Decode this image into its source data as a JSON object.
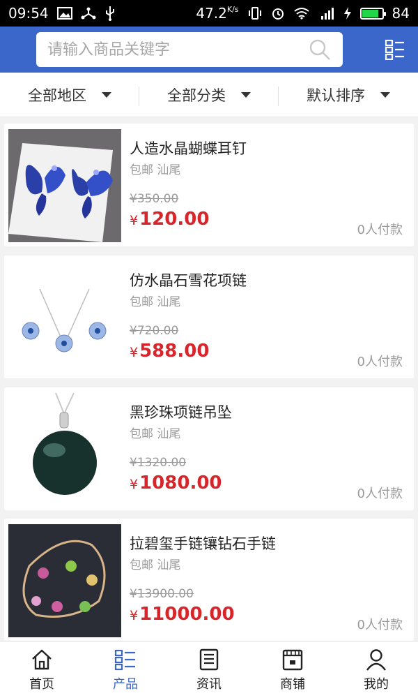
{
  "status_bar": {
    "time": "09:54",
    "speed": "47.2",
    "speed_unit": "K/s",
    "battery": "84"
  },
  "search": {
    "placeholder": "请输入商品关键字"
  },
  "filters": [
    {
      "label": "全部地区"
    },
    {
      "label": "全部分类"
    },
    {
      "label": "默认排序"
    }
  ],
  "products": [
    {
      "name": "人造水晶蝴蝶耳钉",
      "shipping": "包邮",
      "location": "汕尾",
      "old_price": "¥350.00",
      "currency": "¥",
      "price": "120.00",
      "sales": "0人付款"
    },
    {
      "name": "仿水晶石雪花项链",
      "shipping": "包邮",
      "location": "汕尾",
      "old_price": "¥720.00",
      "currency": "¥",
      "price": "588.00",
      "sales": "0人付款"
    },
    {
      "name": "黑珍珠项链吊坠",
      "shipping": "包邮",
      "location": "汕尾",
      "old_price": "¥1320.00",
      "currency": "¥",
      "price": "1080.00",
      "sales": "0人付款"
    },
    {
      "name": "拉碧玺手链镶钻石手链",
      "shipping": "包邮",
      "location": "汕尾",
      "old_price": "¥13900.00",
      "currency": "¥",
      "price": "11000.00",
      "sales": "0人付款"
    }
  ],
  "bottom_nav": [
    {
      "label": "首页",
      "icon": "home-icon"
    },
    {
      "label": "产品",
      "icon": "product-list-icon",
      "active": true
    },
    {
      "label": "资讯",
      "icon": "news-icon"
    },
    {
      "label": "商铺",
      "icon": "shop-icon"
    },
    {
      "label": "我的",
      "icon": "user-icon"
    }
  ],
  "colors": {
    "header": "#3a67c9",
    "price": "#d6262b",
    "active_nav": "#3a67c9"
  }
}
